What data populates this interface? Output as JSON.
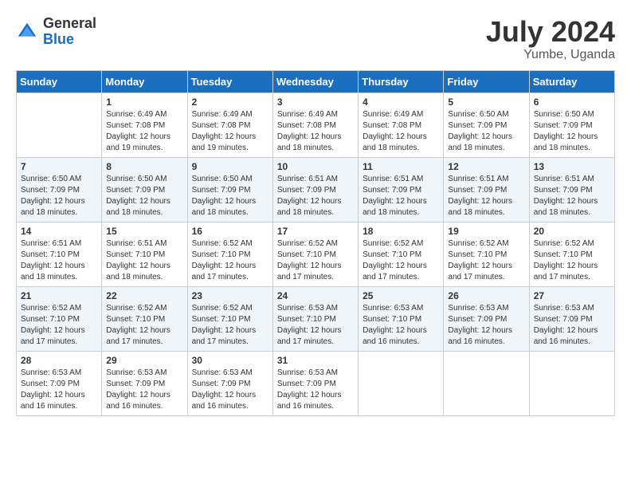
{
  "logo": {
    "general": "General",
    "blue": "Blue"
  },
  "title": "July 2024",
  "location": "Yumbe, Uganda",
  "days_of_week": [
    "Sunday",
    "Monday",
    "Tuesday",
    "Wednesday",
    "Thursday",
    "Friday",
    "Saturday"
  ],
  "weeks": [
    [
      {
        "day": "",
        "sunrise": "",
        "sunset": "",
        "daylight": ""
      },
      {
        "day": "1",
        "sunrise": "Sunrise: 6:49 AM",
        "sunset": "Sunset: 7:08 PM",
        "daylight": "Daylight: 12 hours and 19 minutes."
      },
      {
        "day": "2",
        "sunrise": "Sunrise: 6:49 AM",
        "sunset": "Sunset: 7:08 PM",
        "daylight": "Daylight: 12 hours and 19 minutes."
      },
      {
        "day": "3",
        "sunrise": "Sunrise: 6:49 AM",
        "sunset": "Sunset: 7:08 PM",
        "daylight": "Daylight: 12 hours and 18 minutes."
      },
      {
        "day": "4",
        "sunrise": "Sunrise: 6:49 AM",
        "sunset": "Sunset: 7:08 PM",
        "daylight": "Daylight: 12 hours and 18 minutes."
      },
      {
        "day": "5",
        "sunrise": "Sunrise: 6:50 AM",
        "sunset": "Sunset: 7:09 PM",
        "daylight": "Daylight: 12 hours and 18 minutes."
      },
      {
        "day": "6",
        "sunrise": "Sunrise: 6:50 AM",
        "sunset": "Sunset: 7:09 PM",
        "daylight": "Daylight: 12 hours and 18 minutes."
      }
    ],
    [
      {
        "day": "7",
        "sunrise": "Sunrise: 6:50 AM",
        "sunset": "Sunset: 7:09 PM",
        "daylight": "Daylight: 12 hours and 18 minutes."
      },
      {
        "day": "8",
        "sunrise": "Sunrise: 6:50 AM",
        "sunset": "Sunset: 7:09 PM",
        "daylight": "Daylight: 12 hours and 18 minutes."
      },
      {
        "day": "9",
        "sunrise": "Sunrise: 6:50 AM",
        "sunset": "Sunset: 7:09 PM",
        "daylight": "Daylight: 12 hours and 18 minutes."
      },
      {
        "day": "10",
        "sunrise": "Sunrise: 6:51 AM",
        "sunset": "Sunset: 7:09 PM",
        "daylight": "Daylight: 12 hours and 18 minutes."
      },
      {
        "day": "11",
        "sunrise": "Sunrise: 6:51 AM",
        "sunset": "Sunset: 7:09 PM",
        "daylight": "Daylight: 12 hours and 18 minutes."
      },
      {
        "day": "12",
        "sunrise": "Sunrise: 6:51 AM",
        "sunset": "Sunset: 7:09 PM",
        "daylight": "Daylight: 12 hours and 18 minutes."
      },
      {
        "day": "13",
        "sunrise": "Sunrise: 6:51 AM",
        "sunset": "Sunset: 7:09 PM",
        "daylight": "Daylight: 12 hours and 18 minutes."
      }
    ],
    [
      {
        "day": "14",
        "sunrise": "Sunrise: 6:51 AM",
        "sunset": "Sunset: 7:10 PM",
        "daylight": "Daylight: 12 hours and 18 minutes."
      },
      {
        "day": "15",
        "sunrise": "Sunrise: 6:51 AM",
        "sunset": "Sunset: 7:10 PM",
        "daylight": "Daylight: 12 hours and 18 minutes."
      },
      {
        "day": "16",
        "sunrise": "Sunrise: 6:52 AM",
        "sunset": "Sunset: 7:10 PM",
        "daylight": "Daylight: 12 hours and 17 minutes."
      },
      {
        "day": "17",
        "sunrise": "Sunrise: 6:52 AM",
        "sunset": "Sunset: 7:10 PM",
        "daylight": "Daylight: 12 hours and 17 minutes."
      },
      {
        "day": "18",
        "sunrise": "Sunrise: 6:52 AM",
        "sunset": "Sunset: 7:10 PM",
        "daylight": "Daylight: 12 hours and 17 minutes."
      },
      {
        "day": "19",
        "sunrise": "Sunrise: 6:52 AM",
        "sunset": "Sunset: 7:10 PM",
        "daylight": "Daylight: 12 hours and 17 minutes."
      },
      {
        "day": "20",
        "sunrise": "Sunrise: 6:52 AM",
        "sunset": "Sunset: 7:10 PM",
        "daylight": "Daylight: 12 hours and 17 minutes."
      }
    ],
    [
      {
        "day": "21",
        "sunrise": "Sunrise: 6:52 AM",
        "sunset": "Sunset: 7:10 PM",
        "daylight": "Daylight: 12 hours and 17 minutes."
      },
      {
        "day": "22",
        "sunrise": "Sunrise: 6:52 AM",
        "sunset": "Sunset: 7:10 PM",
        "daylight": "Daylight: 12 hours and 17 minutes."
      },
      {
        "day": "23",
        "sunrise": "Sunrise: 6:52 AM",
        "sunset": "Sunset: 7:10 PM",
        "daylight": "Daylight: 12 hours and 17 minutes."
      },
      {
        "day": "24",
        "sunrise": "Sunrise: 6:53 AM",
        "sunset": "Sunset: 7:10 PM",
        "daylight": "Daylight: 12 hours and 17 minutes."
      },
      {
        "day": "25",
        "sunrise": "Sunrise: 6:53 AM",
        "sunset": "Sunset: 7:10 PM",
        "daylight": "Daylight: 12 hours and 16 minutes."
      },
      {
        "day": "26",
        "sunrise": "Sunrise: 6:53 AM",
        "sunset": "Sunset: 7:09 PM",
        "daylight": "Daylight: 12 hours and 16 minutes."
      },
      {
        "day": "27",
        "sunrise": "Sunrise: 6:53 AM",
        "sunset": "Sunset: 7:09 PM",
        "daylight": "Daylight: 12 hours and 16 minutes."
      }
    ],
    [
      {
        "day": "28",
        "sunrise": "Sunrise: 6:53 AM",
        "sunset": "Sunset: 7:09 PM",
        "daylight": "Daylight: 12 hours and 16 minutes."
      },
      {
        "day": "29",
        "sunrise": "Sunrise: 6:53 AM",
        "sunset": "Sunset: 7:09 PM",
        "daylight": "Daylight: 12 hours and 16 minutes."
      },
      {
        "day": "30",
        "sunrise": "Sunrise: 6:53 AM",
        "sunset": "Sunset: 7:09 PM",
        "daylight": "Daylight: 12 hours and 16 minutes."
      },
      {
        "day": "31",
        "sunrise": "Sunrise: 6:53 AM",
        "sunset": "Sunset: 7:09 PM",
        "daylight": "Daylight: 12 hours and 16 minutes."
      },
      {
        "day": "",
        "sunrise": "",
        "sunset": "",
        "daylight": ""
      },
      {
        "day": "",
        "sunrise": "",
        "sunset": "",
        "daylight": ""
      },
      {
        "day": "",
        "sunrise": "",
        "sunset": "",
        "daylight": ""
      }
    ]
  ]
}
